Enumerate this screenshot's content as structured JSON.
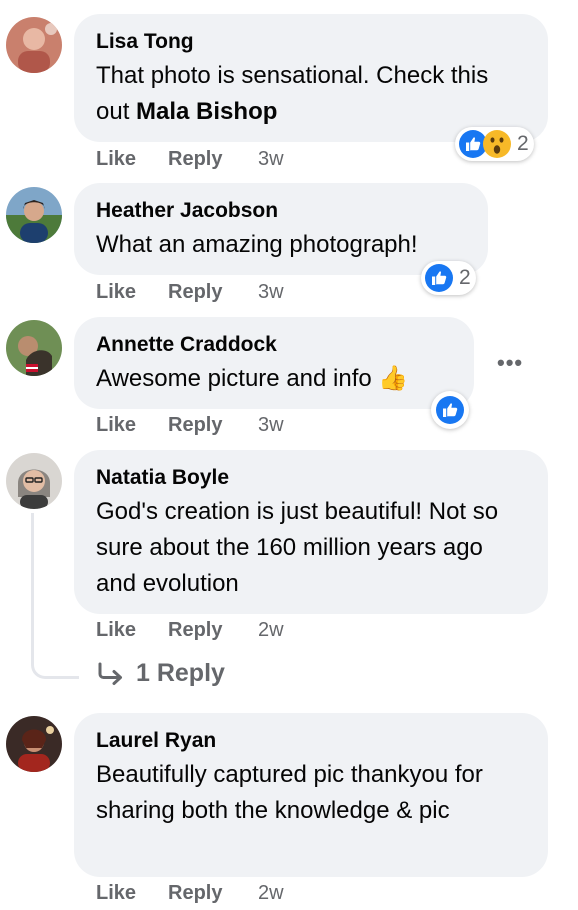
{
  "comments": [
    {
      "author": "Lisa Tong",
      "text_pre": "That photo is sensational. Check this out ",
      "mention": "Mala Bishop",
      "actions": {
        "like": "Like",
        "reply": "Reply",
        "time": "3w"
      },
      "reactions": {
        "types": [
          "like-icon",
          "wow-icon"
        ],
        "count": "2"
      }
    },
    {
      "author": "Heather Jacobson",
      "text": "What an amazing photograph!",
      "actions": {
        "like": "Like",
        "reply": "Reply",
        "time": "3w"
      },
      "reactions": {
        "types": [
          "like-icon"
        ],
        "count": "2"
      }
    },
    {
      "author": "Annette Craddock",
      "text": "Awesome picture and info 👍",
      "actions": {
        "like": "Like",
        "reply": "Reply",
        "time": "3w"
      },
      "reactions": {
        "types": [
          "like-icon"
        ],
        "count": ""
      },
      "more_label": "•••"
    },
    {
      "author": "Natatia Boyle",
      "text": "God's creation is just beautiful! Not so sure about the 160 million years ago and evolution",
      "actions": {
        "like": "Like",
        "reply": "Reply",
        "time": "2w"
      },
      "replies_label": "1 Reply"
    },
    {
      "author": "Laurel Ryan",
      "text": "Beautifully captured pic thankyou for sharing both the knowledge & pic",
      "actions": {
        "like": "Like",
        "reply": "Reply",
        "time": "2w"
      }
    }
  ],
  "colors": {
    "bubble": "#f0f2f5",
    "secondary_text": "#65676b",
    "like_blue": "#1877f2",
    "wow_yellow": "#f7b928"
  }
}
